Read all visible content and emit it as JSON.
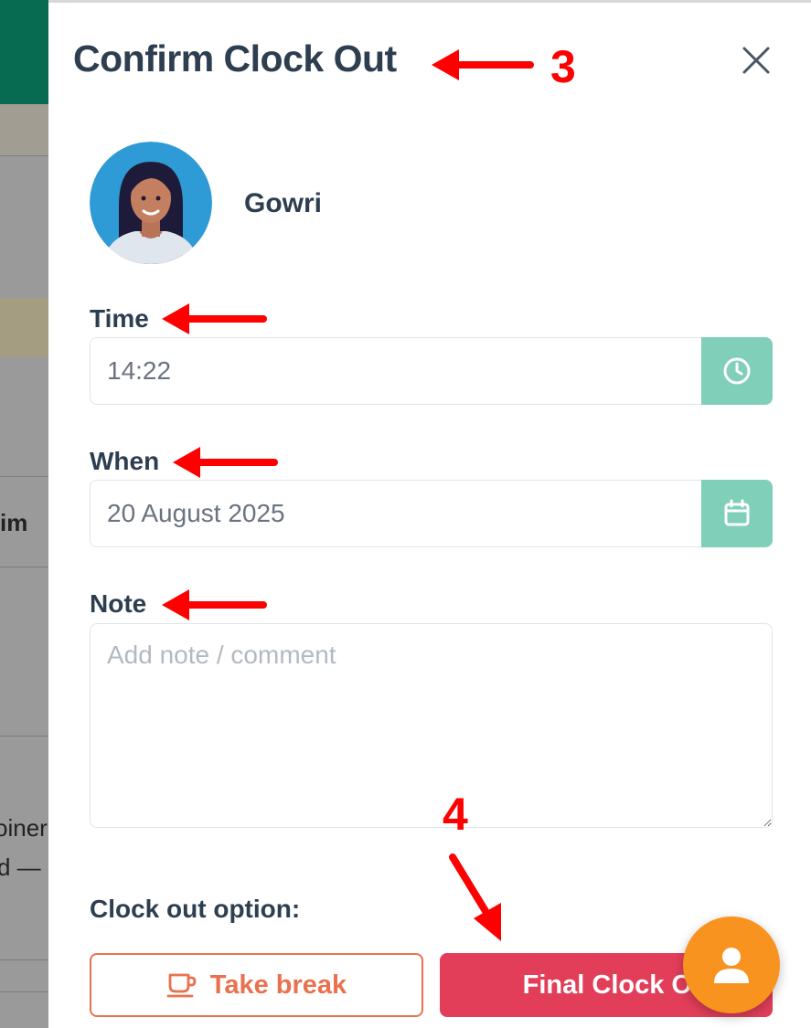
{
  "background": {
    "partial_texts": [
      "im",
      "oiner",
      "d —"
    ]
  },
  "dialog": {
    "title": "Confirm Clock Out",
    "close_icon": "close-icon",
    "user": {
      "name": "Gowri",
      "avatar_icon": "user-avatar"
    }
  },
  "form": {
    "time": {
      "label": "Time",
      "value": "14:22",
      "icon": "clock-icon"
    },
    "when": {
      "label": "When",
      "value": "20 August 2025",
      "icon": "calendar-icon"
    },
    "note": {
      "label": "Note",
      "placeholder": "Add note / comment",
      "value": ""
    }
  },
  "options": {
    "label": "Clock out option:",
    "take_break": {
      "label": "Take break",
      "icon": "coffee-cup-icon"
    },
    "final_clock_out": {
      "label": "Final Clock Out"
    }
  },
  "fab": {
    "icon": "person-icon"
  },
  "annotations": [
    "3",
    "4"
  ],
  "colors": {
    "brand_green": "#076b51",
    "title_text": "#2d3e50",
    "addon_green": "#80cfb9",
    "break_orange": "#e8724f",
    "final_red": "#e23e5a",
    "fab_orange": "#f7931e",
    "annotation_red": "#ff0000"
  }
}
